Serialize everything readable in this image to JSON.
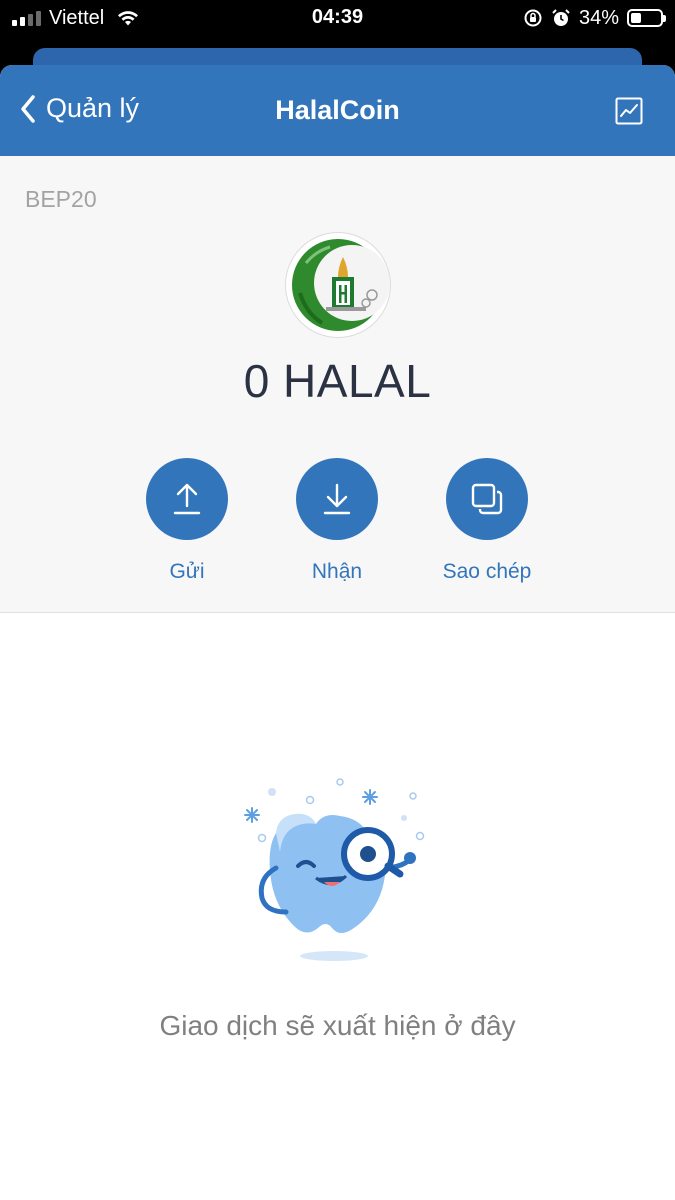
{
  "status_bar": {
    "carrier": "Viettel",
    "time": "04:39",
    "battery_percent": "34%",
    "battery_level": 0.34
  },
  "nav": {
    "back_label": "Quản lý",
    "title": "HalalCoin",
    "chart_icon": "chart-icon"
  },
  "token": {
    "network": "BEP20",
    "balance": "0 HALAL",
    "logo_icon": "halalcoin-logo"
  },
  "actions": [
    {
      "label": "Gửi",
      "icon": "upload-arrow-icon"
    },
    {
      "label": "Nhận",
      "icon": "download-arrow-icon"
    },
    {
      "label": "Sao chép",
      "icon": "copy-icon"
    }
  ],
  "empty_state": {
    "message": "Giao dịch sẽ xuất hiện ở đây",
    "illustration": "mascot-magnifier-illustration"
  },
  "colors": {
    "brand_blue": "#3375bb",
    "text_dark": "#2b3243",
    "text_muted": "#808080"
  }
}
